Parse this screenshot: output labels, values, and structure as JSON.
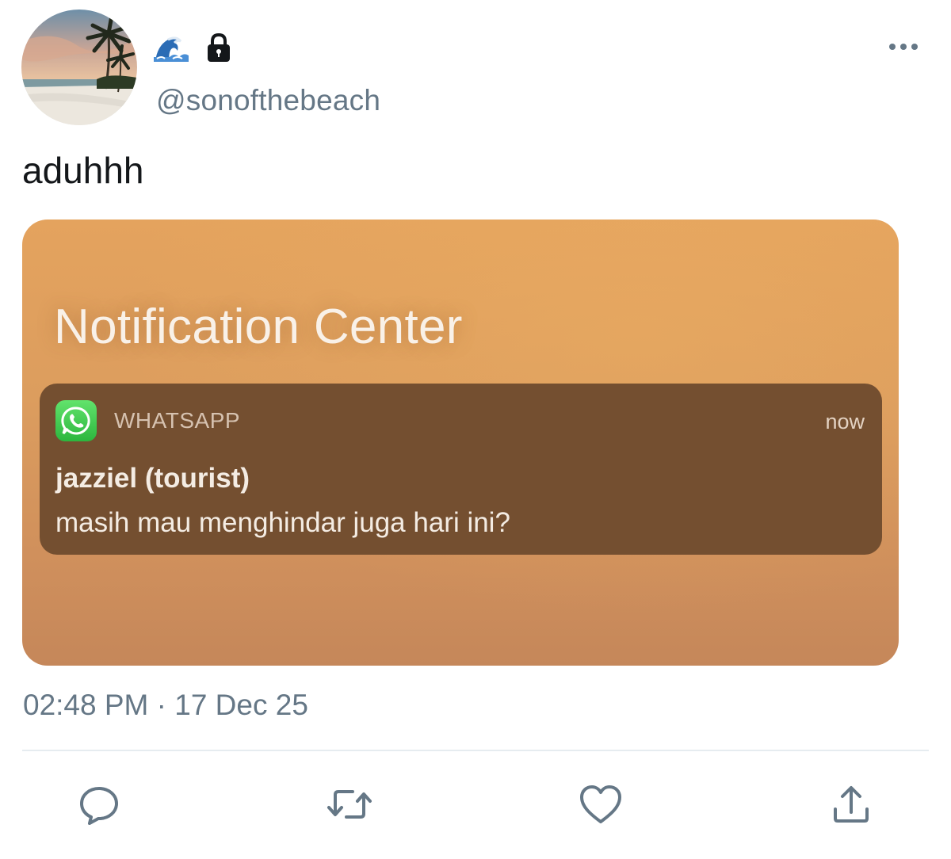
{
  "user": {
    "handle": "@sonofthebeach",
    "display_name_icons": [
      "wave-emoji-icon",
      "lock-icon"
    ]
  },
  "tweet": {
    "text": "aduhhh",
    "timestamp": "02:48 PM · 17 Dec 25"
  },
  "media": {
    "title": "Notification Center",
    "notification": {
      "app": "WHATSAPP",
      "time": "now",
      "sender": "jazziel (tourist)",
      "message": "masih mau menghindar juga hari ini?"
    }
  },
  "actions": [
    "reply-icon",
    "retweet-icon",
    "like-icon",
    "share-icon"
  ],
  "colors": {
    "secondary_text": "#657786",
    "notification_bg": "#744f30",
    "media_bg": "#dc9d5e",
    "whatsapp_green": "#2cb63e"
  }
}
